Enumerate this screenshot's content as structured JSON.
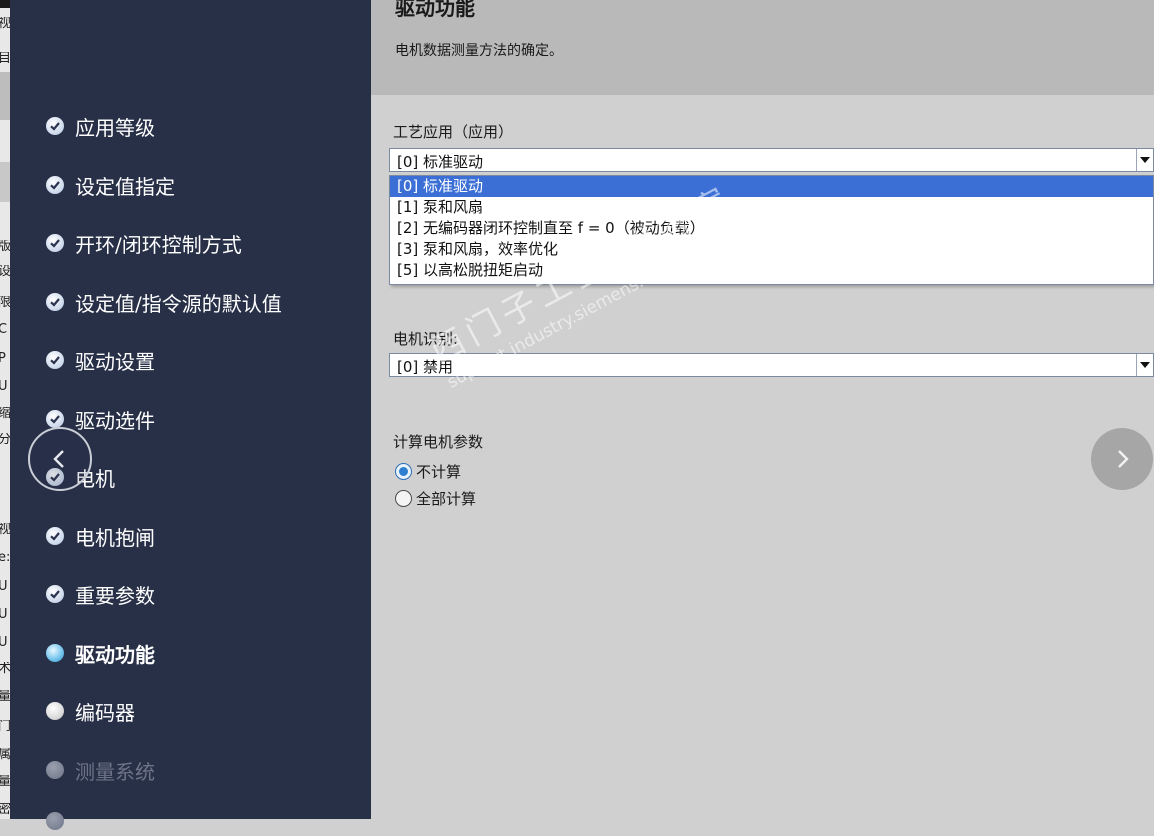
{
  "left_strip": {
    "glyphs": [
      "视",
      "目",
      "版",
      "设",
      "限",
      "C",
      "P",
      "U",
      "缩",
      "分",
      "视",
      "e:",
      "U",
      "U",
      "U",
      "术",
      "量",
      "门",
      "属",
      "量",
      "密"
    ]
  },
  "sidebar": {
    "steps": [
      {
        "label": "应用等级",
        "state": "done"
      },
      {
        "label": "设定值指定",
        "state": "done"
      },
      {
        "label": "开环/闭环控制方式",
        "state": "done"
      },
      {
        "label": "设定值/指令源的默认值",
        "state": "done"
      },
      {
        "label": "驱动设置",
        "state": "done"
      },
      {
        "label": "驱动选件",
        "state": "done"
      },
      {
        "label": "电机",
        "state": "done"
      },
      {
        "label": "电机抱闸",
        "state": "done"
      },
      {
        "label": "重要参数",
        "state": "done"
      },
      {
        "label": "驱动功能",
        "state": "current"
      },
      {
        "label": "编码器",
        "state": "pending"
      },
      {
        "label": "测量系统",
        "state": "disabled"
      }
    ]
  },
  "header": {
    "title": "驱动功能",
    "description": "电机数据测量方法的确定。"
  },
  "main": {
    "tech_app": {
      "label": "工艺应用（应用）",
      "value": "[0] 标准驱动",
      "options": [
        "[0] 标准驱动",
        "[1] 泵和风扇",
        "[2] 无编码器闭环控制直至 f = 0（被动负载）",
        "[3] 泵和风扇，效率优化",
        "[5] 以高松脱扭矩启动"
      ],
      "selected_index": 0
    },
    "motor_id": {
      "label": "电机识别:",
      "value": "[0] 禁用"
    },
    "calc_params": {
      "label": "计算电机参数",
      "options": [
        "不计算",
        "全部计算"
      ],
      "selected_index": 0
    }
  },
  "watermark": {
    "line1": "西门子工业  找答案",
    "line2": "support.industry.siemens.com/cs"
  },
  "colors": {
    "sidebar_bg": "#283048",
    "header_bg": "#b9b9b9",
    "content_bg": "#d0d0d0",
    "selection": "#3b6fd6"
  }
}
